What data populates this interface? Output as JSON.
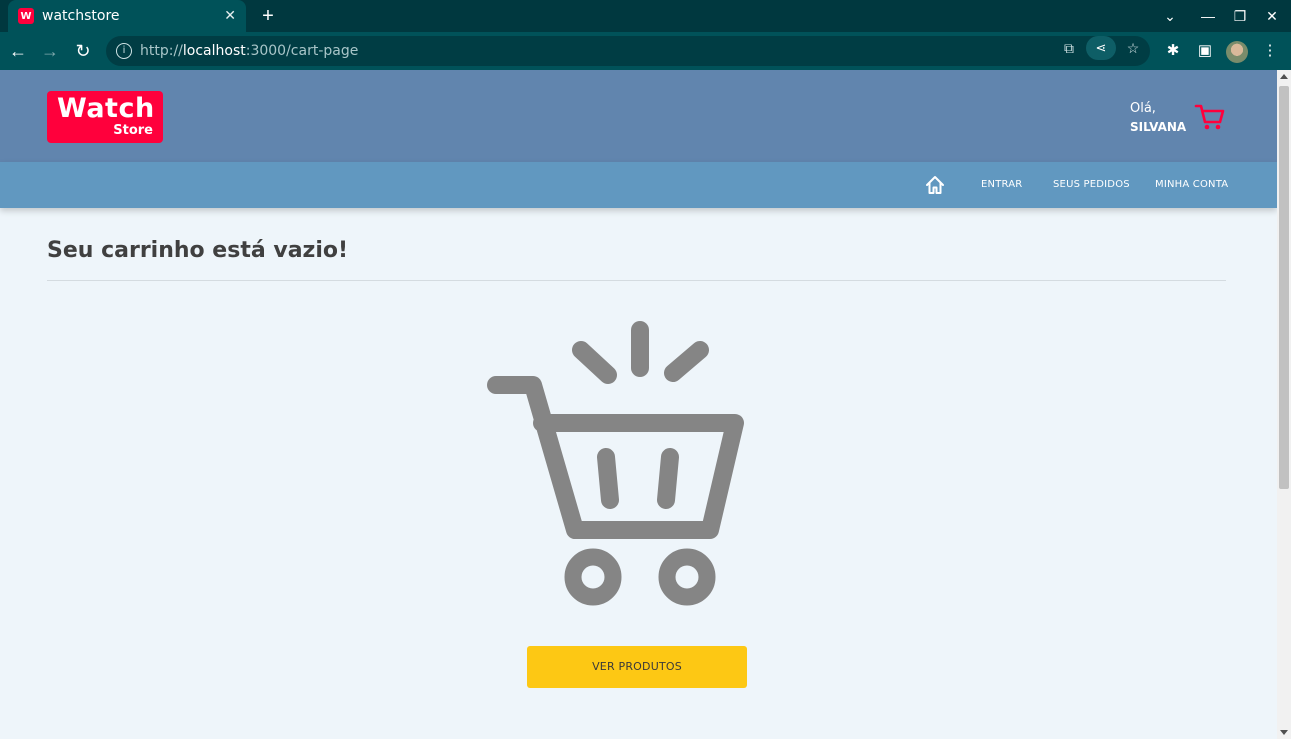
{
  "browser": {
    "tab_title": "watchstore",
    "tab_favicon_letter": "W",
    "url_prefix": "http://",
    "url_host": "localhost",
    "url_path": ":3000/cart-page"
  },
  "header": {
    "logo_line1": "Watch",
    "logo_line2": "Store",
    "greeting": "Olá,",
    "user_name": "SILVANA"
  },
  "nav": {
    "items": [
      {
        "label": "ENTRAR"
      },
      {
        "label": "SEUS PEDIDOS"
      },
      {
        "label": "MINHA CONTA"
      }
    ]
  },
  "main": {
    "title": "Seu carrinho está vazio!",
    "button_label": "VER PRODUTOS"
  },
  "colors": {
    "brand_red": "#ff003c",
    "header_top": "#6185ae",
    "header_nav": "#6198c0",
    "cta_yellow": "#fdc814",
    "empty_icon_gray": "#858585"
  }
}
